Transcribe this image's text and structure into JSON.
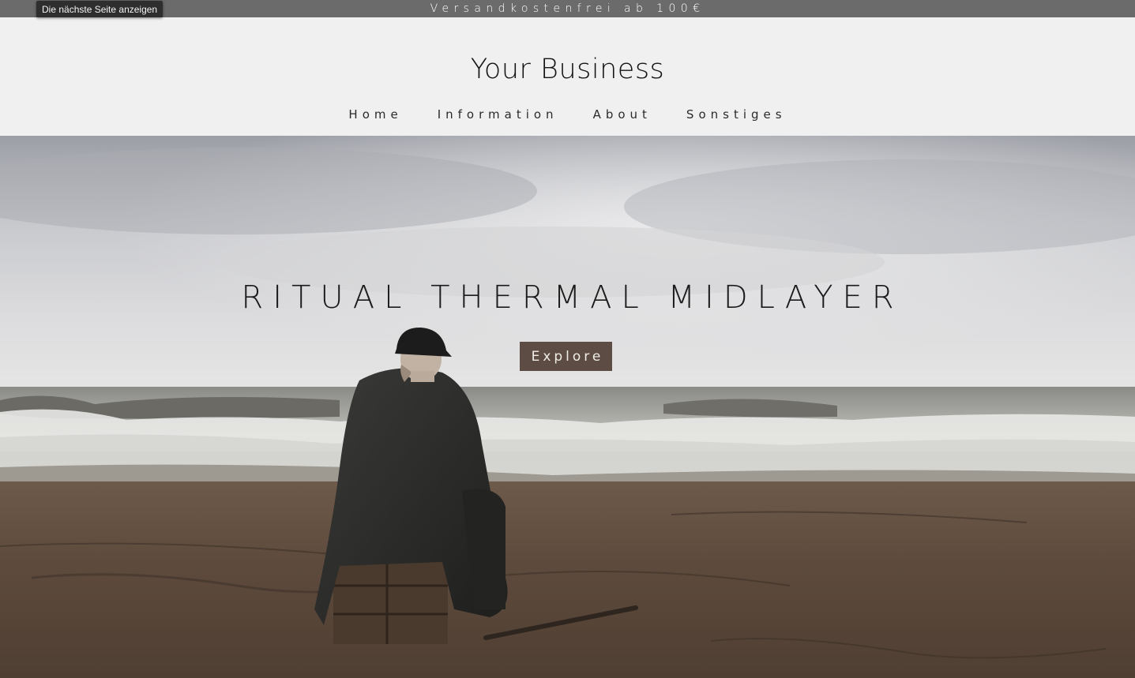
{
  "tooltip": {
    "text": "Die nächste Seite anzeigen"
  },
  "announcement": {
    "text": "Versandkostenfrei ab 100€"
  },
  "header": {
    "brand": "Your Business",
    "nav": [
      {
        "label": "Home"
      },
      {
        "label": "Information"
      },
      {
        "label": "About"
      },
      {
        "label": "Sonstiges"
      }
    ]
  },
  "hero": {
    "title": "RITUAL THERMAL MIDLAYER",
    "button_label": "Explore",
    "button_color": "#5c4c43",
    "image_subject": "man-sitting-on-beach-photo"
  },
  "colors": {
    "announcement_bg": "#6b6b6b",
    "header_bg": "#f0f0f0"
  }
}
